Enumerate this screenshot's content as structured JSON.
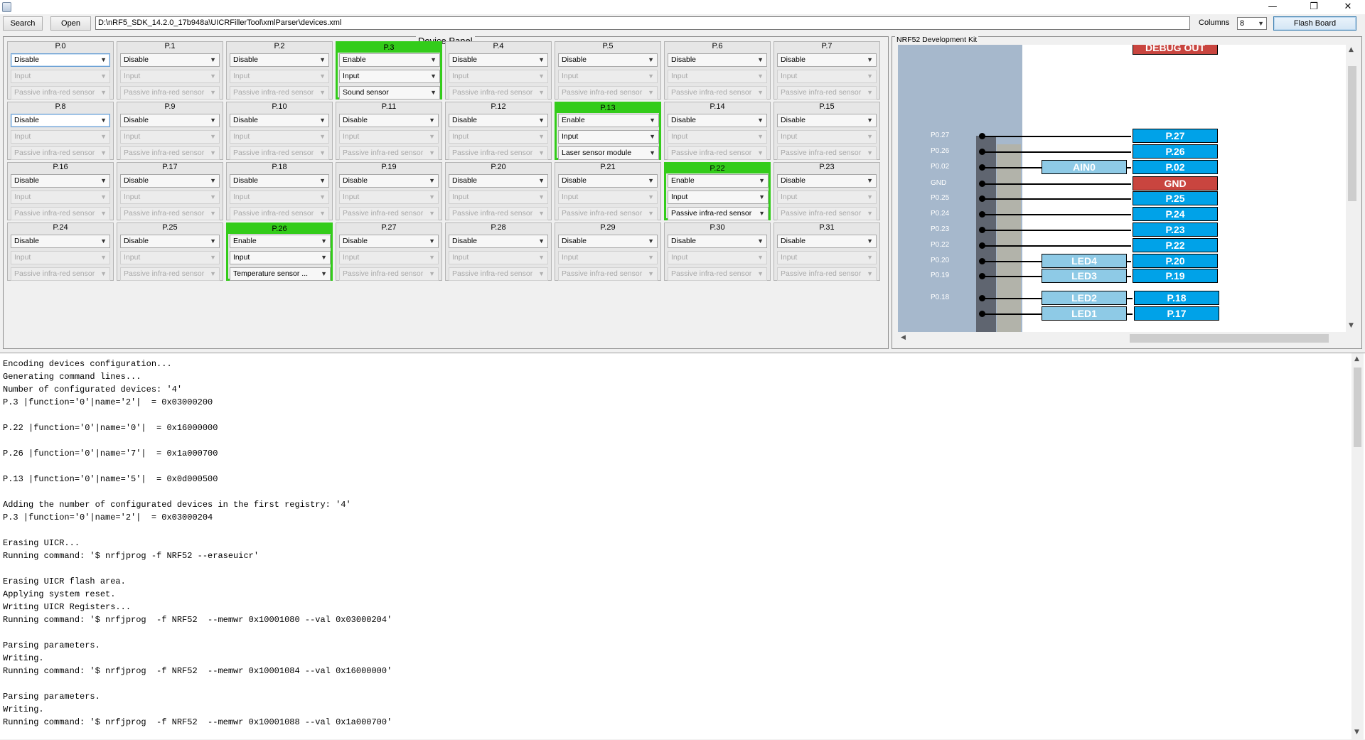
{
  "window": {
    "minimize_glyph": "—",
    "maximize_glyph": "❐",
    "close_glyph": "✕"
  },
  "toolbar": {
    "search_label": "Search",
    "open_label": "Open",
    "path": "D:\\nRF5_SDK_14.2.0_17b948a\\UICRFillerTool\\xmlParser\\devices.xml",
    "columns_label": "Columns",
    "columns_value": "8",
    "flash_label": "Flash Board"
  },
  "device_panel": {
    "title": "Device Panel",
    "pins": [
      {
        "label": "P.0",
        "state": "Disable",
        "direction": "Input",
        "sensor": "Passive infra-red sensor",
        "active": false,
        "selected": true
      },
      {
        "label": "P.1",
        "state": "Disable",
        "direction": "Input",
        "sensor": "Passive infra-red sensor",
        "active": false
      },
      {
        "label": "P.2",
        "state": "Disable",
        "direction": "Input",
        "sensor": "Passive infra-red sensor",
        "active": false
      },
      {
        "label": "P.3",
        "state": "Enable",
        "direction": "Input",
        "sensor": "Sound sensor",
        "active": true
      },
      {
        "label": "P.4",
        "state": "Disable",
        "direction": "Input",
        "sensor": "Passive infra-red sensor",
        "active": false
      },
      {
        "label": "P.5",
        "state": "Disable",
        "direction": "Input",
        "sensor": "Passive infra-red sensor",
        "active": false
      },
      {
        "label": "P.6",
        "state": "Disable",
        "direction": "Input",
        "sensor": "Passive infra-red sensor",
        "active": false
      },
      {
        "label": "P.7",
        "state": "Disable",
        "direction": "Input",
        "sensor": "Passive infra-red sensor",
        "active": false
      },
      {
        "label": "P.8",
        "state": "Disable",
        "direction": "Input",
        "sensor": "Passive infra-red sensor",
        "active": false,
        "selected": true
      },
      {
        "label": "P.9",
        "state": "Disable",
        "direction": "Input",
        "sensor": "Passive infra-red sensor",
        "active": false
      },
      {
        "label": "P.10",
        "state": "Disable",
        "direction": "Input",
        "sensor": "Passive infra-red sensor",
        "active": false
      },
      {
        "label": "P.11",
        "state": "Disable",
        "direction": "Input",
        "sensor": "Passive infra-red sensor",
        "active": false
      },
      {
        "label": "P.12",
        "state": "Disable",
        "direction": "Input",
        "sensor": "Passive infra-red sensor",
        "active": false
      },
      {
        "label": "P.13",
        "state": "Enable",
        "direction": "Input",
        "sensor": "Laser sensor module",
        "active": true
      },
      {
        "label": "P.14",
        "state": "Disable",
        "direction": "Input",
        "sensor": "Passive infra-red sensor",
        "active": false
      },
      {
        "label": "P.15",
        "state": "Disable",
        "direction": "Input",
        "sensor": "Passive infra-red sensor",
        "active": false
      },
      {
        "label": "P.16",
        "state": "Disable",
        "direction": "Input",
        "sensor": "Passive infra-red sensor",
        "active": false
      },
      {
        "label": "P.17",
        "state": "Disable",
        "direction": "Input",
        "sensor": "Passive infra-red sensor",
        "active": false
      },
      {
        "label": "P.18",
        "state": "Disable",
        "direction": "Input",
        "sensor": "Passive infra-red sensor",
        "active": false
      },
      {
        "label": "P.19",
        "state": "Disable",
        "direction": "Input",
        "sensor": "Passive infra-red sensor",
        "active": false
      },
      {
        "label": "P.20",
        "state": "Disable",
        "direction": "Input",
        "sensor": "Passive infra-red sensor",
        "active": false
      },
      {
        "label": "P.21",
        "state": "Disable",
        "direction": "Input",
        "sensor": "Passive infra-red sensor",
        "active": false
      },
      {
        "label": "P.22",
        "state": "Enable",
        "direction": "Input",
        "sensor": "Passive infra-red sensor",
        "active": true
      },
      {
        "label": "P.23",
        "state": "Disable",
        "direction": "Input",
        "sensor": "Passive infra-red sensor",
        "active": false
      },
      {
        "label": "P.24",
        "state": "Disable",
        "direction": "Input",
        "sensor": "Passive infra-red sensor",
        "active": false
      },
      {
        "label": "P.25",
        "state": "Disable",
        "direction": "Input",
        "sensor": "Passive infra-red sensor",
        "active": false
      },
      {
        "label": "P.26",
        "state": "Enable",
        "direction": "Input",
        "sensor": "Temperature sensor ...",
        "active": true
      },
      {
        "label": "P.27",
        "state": "Disable",
        "direction": "Input",
        "sensor": "Passive infra-red sensor",
        "active": false
      },
      {
        "label": "P.28",
        "state": "Disable",
        "direction": "Input",
        "sensor": "Passive infra-red sensor",
        "active": false
      },
      {
        "label": "P.29",
        "state": "Disable",
        "direction": "Input",
        "sensor": "Passive infra-red sensor",
        "active": false
      },
      {
        "label": "P.30",
        "state": "Disable",
        "direction": "Input",
        "sensor": "Passive infra-red sensor",
        "active": false
      },
      {
        "label": "P.31",
        "state": "Disable",
        "direction": "Input",
        "sensor": "Passive infra-red sensor",
        "active": false
      }
    ]
  },
  "board_panel": {
    "title": "NRF52 Development Kit",
    "debug_label": "DEBUG OUT",
    "silkscreen": [
      "P0.27",
      "P0.26",
      "P0.02",
      "GND",
      "P0.25",
      "P0.24",
      "P0.23",
      "P0.22",
      "P0.20",
      "P0.19",
      "P0.18"
    ],
    "pin_tags": [
      {
        "label": "P.27",
        "kind": "pin"
      },
      {
        "label": "P.26",
        "kind": "pin"
      },
      {
        "label": "P.02",
        "kind": "pin"
      },
      {
        "label": "GND",
        "kind": "gnd"
      },
      {
        "label": "P.25",
        "kind": "pin"
      },
      {
        "label": "P.24",
        "kind": "pin"
      },
      {
        "label": "P.23",
        "kind": "pin"
      },
      {
        "label": "P.22",
        "kind": "pin"
      },
      {
        "label": "P.20",
        "kind": "pin"
      },
      {
        "label": "P.19",
        "kind": "pin"
      },
      {
        "label": "P.18",
        "kind": "pin"
      },
      {
        "label": "P.17",
        "kind": "pin"
      }
    ],
    "aux_tags": [
      "AIN0",
      "LED4",
      "LED3",
      "LED2",
      "LED1"
    ],
    "colors": {
      "pin": "#00a2e8",
      "gnd": "#c9453f",
      "led": "#8ecae6",
      "pcb": "#a6b8cc"
    }
  },
  "console": {
    "lines": [
      "Encoding devices configuration...",
      "Generating command lines...",
      "Number of configurated devices: '4'",
      "P.3 |function='0'|name='2'|  = 0x03000200",
      "",
      "P.22 |function='0'|name='0'|  = 0x16000000",
      "",
      "P.26 |function='0'|name='7'|  = 0x1a000700",
      "",
      "P.13 |function='0'|name='5'|  = 0x0d000500",
      "",
      "Adding the number of configurated devices in the first registry: '4'",
      "P.3 |function='0'|name='2'|  = 0x03000204",
      "",
      "Erasing UICR...",
      "Running command: '$ nrfjprog -f NRF52 --eraseuicr'",
      "",
      "Erasing UICR flash area.",
      "Applying system reset.",
      "Writing UICR Registers...",
      "Running command: '$ nrfjprog  -f NRF52  --memwr 0x10001080 --val 0x03000204'",
      "",
      "Parsing parameters.",
      "Writing.",
      "Running command: '$ nrfjprog  -f NRF52  --memwr 0x10001084 --val 0x16000000'",
      "",
      "Parsing parameters.",
      "Writing.",
      "Running command: '$ nrfjprog  -f NRF52  --memwr 0x10001088 --val 0x1a000700'"
    ]
  }
}
